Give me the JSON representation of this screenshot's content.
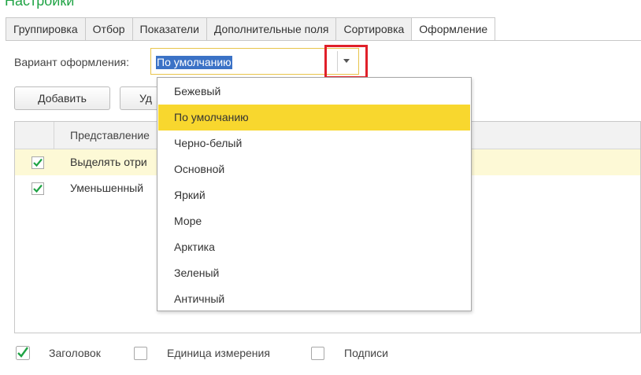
{
  "header": {
    "title": "Настройки"
  },
  "tabs": [
    {
      "label": "Группировка"
    },
    {
      "label": "Отбор"
    },
    {
      "label": "Показатели"
    },
    {
      "label": "Дополнительные поля"
    },
    {
      "label": "Сортировка"
    },
    {
      "label": "Оформление",
      "active": true
    }
  ],
  "variant": {
    "label": "Вариант оформления:",
    "value": "По умолчанию"
  },
  "toolbar": {
    "add_label": "Добавить",
    "delete_label": "Уд"
  },
  "table": {
    "columns": [
      "Представление"
    ],
    "rows": [
      {
        "checked": true,
        "text": "Выделять отри",
        "selected": true
      },
      {
        "checked": true,
        "text": "Уменьшенный"
      }
    ]
  },
  "dropdown": {
    "options": [
      "Бежевый",
      "По умолчанию",
      "Черно-белый",
      "Основной",
      "Яркий",
      "Море",
      "Арктика",
      "Зеленый",
      "Античный"
    ],
    "selected_index": 1
  },
  "footer": {
    "checkboxes": [
      {
        "label": "Заголовок",
        "checked": true
      },
      {
        "label": "Единица измерения",
        "checked": false
      },
      {
        "label": "Подписи",
        "checked": false
      }
    ]
  },
  "colors": {
    "accent": "#1fa344",
    "highlight": "#f8d72e",
    "selection": "#3b72c6",
    "callout": "#e0202a"
  }
}
